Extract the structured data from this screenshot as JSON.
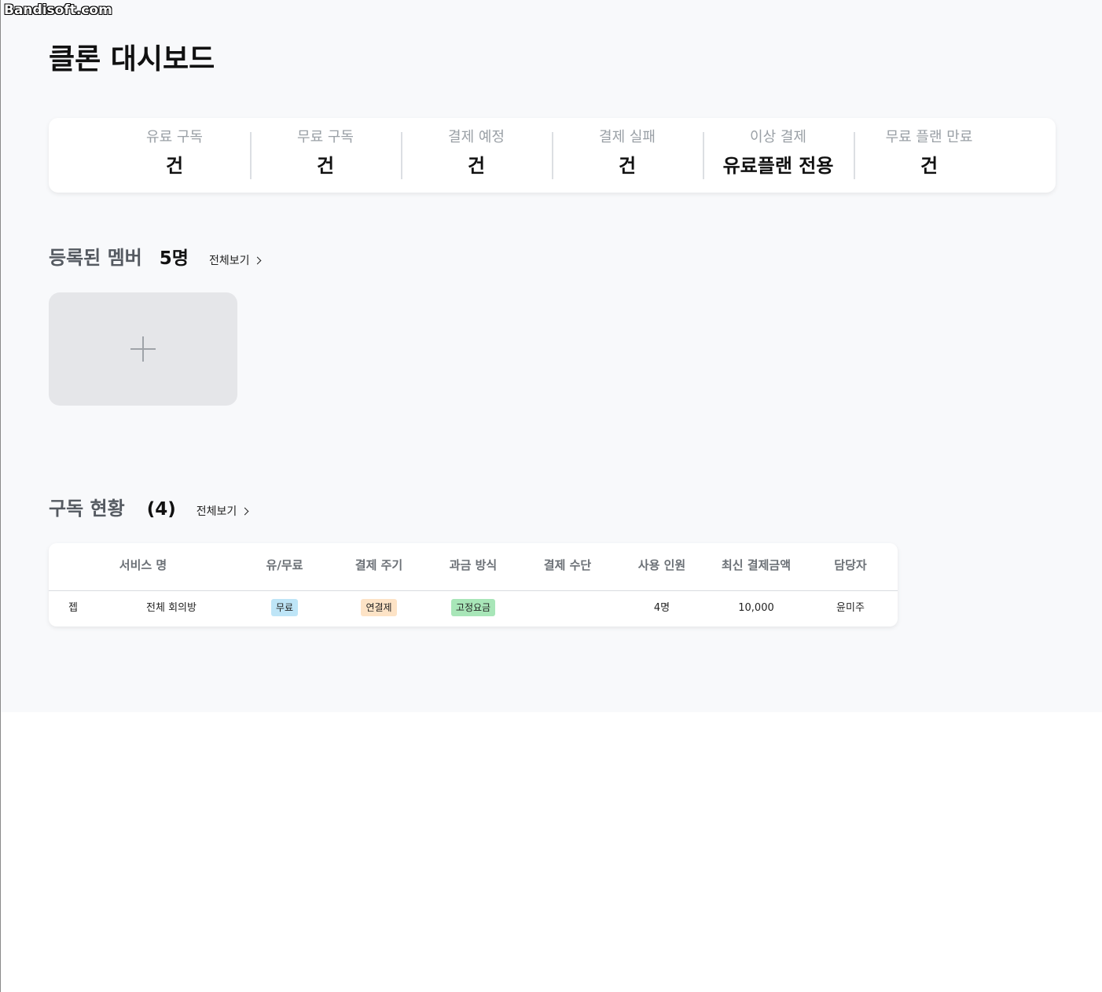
{
  "watermark": "Bandisoft.com",
  "page": {
    "title": "클론 대시보드"
  },
  "stats": [
    {
      "label": "유료 구독",
      "value": "건"
    },
    {
      "label": "무료 구독",
      "value": "건"
    },
    {
      "label": "결제 예정",
      "value": "건"
    },
    {
      "label": "결제 실패",
      "value": "건"
    },
    {
      "label": "이상 결제",
      "value": "유료플랜 전용"
    },
    {
      "label": "무료 플랜 만료",
      "value": "건"
    }
  ],
  "members": {
    "title": "등록된 멤버",
    "count": "5명",
    "view_all": "전체보기"
  },
  "subscriptions": {
    "title": "구독 현황",
    "count": "(4)",
    "view_all": "전체보기",
    "columns": [
      "서비스 명",
      "유/무료",
      "결제 주기",
      "과금 방식",
      "결제 수단",
      "사용 인원",
      "최신 결제금액",
      "담당자"
    ],
    "rows": [
      {
        "icon_text": "젭",
        "service": "전체 회의방",
        "paid": "무료",
        "cycle": "연결제",
        "billing": "고정요금",
        "method": "",
        "users": "4명",
        "amount": "10,000",
        "manager": "윤미주"
      }
    ]
  },
  "colors": {
    "background": "#f8f9fb",
    "badge_blue": "#bee5f7",
    "badge_orange": "#fde3c6",
    "badge_green": "#a8e6b8"
  },
  "icons": {
    "add": "plus-icon",
    "view_all": "chevron-right-icon"
  }
}
